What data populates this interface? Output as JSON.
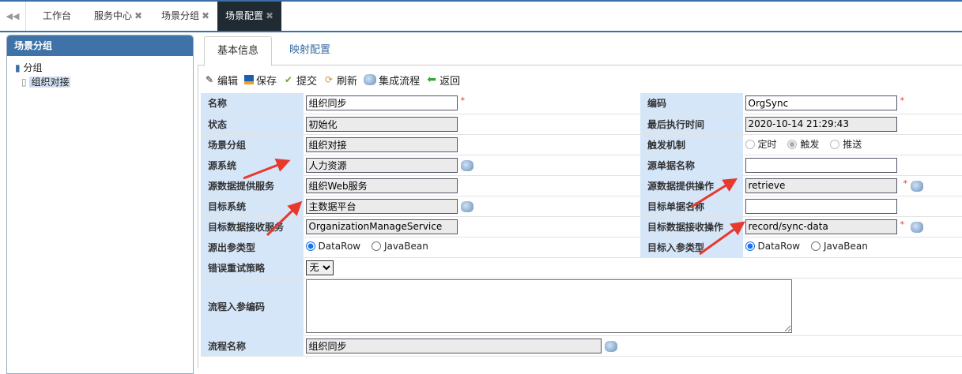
{
  "topbar": {
    "tabs": [
      {
        "label": "工作台"
      },
      {
        "label": "服务中心",
        "close": "✖"
      },
      {
        "label": "场景分组",
        "close": "✖"
      },
      {
        "label": "场景配置",
        "close": "✖"
      }
    ]
  },
  "sidebar": {
    "title": "场景分组",
    "root": "分组",
    "child": "组织对接"
  },
  "tabs": [
    "基本信息",
    "映射配置"
  ],
  "toolbar": [
    "编辑",
    "保存",
    "提交",
    "刷新",
    "集成流程",
    "返回"
  ],
  "form": {
    "name_label": "名称",
    "name": "组织同步",
    "code_label": "编码",
    "code": "OrgSync",
    "status_label": "状态",
    "status": "初始化",
    "last_run_label": "最后执行时间",
    "last_run": "2020-10-14 21:29:43",
    "group_label": "场景分组",
    "group": "组织对接",
    "trigger_label": "触发机制",
    "trigger_options": [
      "定时",
      "触发",
      "推送"
    ],
    "src_sys_label": "源系统",
    "src_sys": "人力资源",
    "src_doc_label": "源单据名称",
    "src_doc": "",
    "src_svc_label": "源数据提供服务",
    "src_svc": "组织Web服务",
    "src_op_label": "源数据提供操作",
    "src_op": "retrieve",
    "tgt_sys_label": "目标系统",
    "tgt_sys": "主数据平台",
    "tgt_doc_label": "目标单据名称",
    "tgt_doc": "",
    "tgt_svc_label": "目标数据接收服务",
    "tgt_svc": "OrganizationManageService",
    "tgt_op_label": "目标数据接收操作",
    "tgt_op": "record/sync-data",
    "src_out_label": "源出参类型",
    "tgt_in_label": "目标入参类型",
    "param_options": [
      "DataRow",
      "JavaBean"
    ],
    "retry_label": "错误重试策略",
    "retry": "无",
    "flow_code_label": "流程入参编码",
    "flow_code": "",
    "flow_name_label": "流程名称",
    "flow_name": "组织同步",
    "req": "*"
  },
  "colors": {
    "accent": "#3f73a8",
    "label_bg": "#d6e6f9",
    "arrow": "#e8392f"
  }
}
